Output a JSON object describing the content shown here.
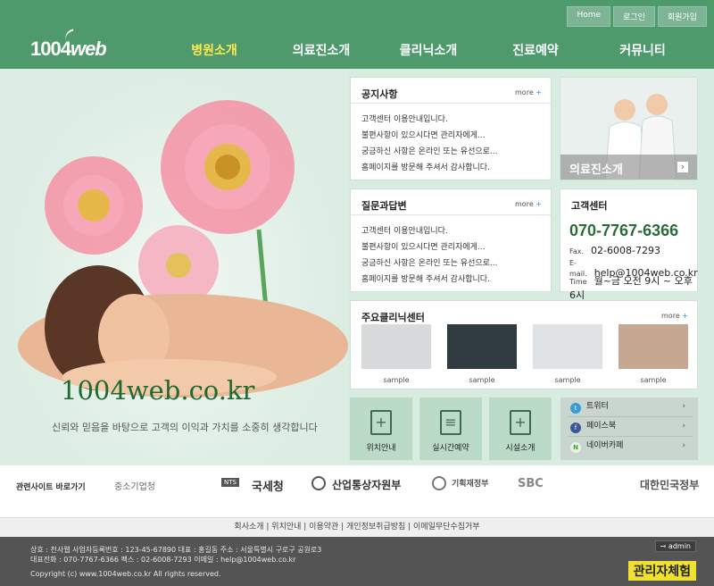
{
  "header": {
    "logo": "1004",
    "logo_web": "web"
  },
  "topnav": [
    "Home",
    "로그인",
    "회원가입"
  ],
  "nav": [
    "병원소개",
    "의료진소개",
    "클리닉소개",
    "진료예약",
    "커뮤니티"
  ],
  "hero": {
    "domain": "1004web.co.kr",
    "slogan": "신뢰와 믿음을 바탕으로 고객의 이익과 가치를 소중히 생각합니다"
  },
  "notice": {
    "title": "공지사항",
    "more": "more",
    "items": [
      "고객센터 이용안내입니다.",
      "불편사항이 있으시다면 관리자에게...",
      "궁금하신 사항은 온라인 또는 유선으로...",
      "홈페이지를 방문해 주셔서 감사합니다."
    ]
  },
  "qna": {
    "title": "질문과답변",
    "more": "more",
    "items": [
      "고객센터 이용안내입니다.",
      "불편사항이 있으시다면 관리자에게...",
      "궁금하신 사항은 온라인 또는 유선으로...",
      "홈페이지를 방문해 주셔서 감사합니다."
    ]
  },
  "staff": {
    "label": "의료진소개",
    "arrow": "›"
  },
  "customer_center": {
    "title": "고객센터",
    "phone": "070-7767-6366",
    "fax_label": "Fax.",
    "fax": "02-6008-7293",
    "email_label": "E-mail.",
    "email": "help@1004web.co.kr",
    "time_label": "Time",
    "time": "월~금 오전 9시 ~ 오후 6시"
  },
  "clinic": {
    "title": "주요클리닉센터",
    "more": "more",
    "items": [
      "sample",
      "sample",
      "sample",
      "sample"
    ]
  },
  "quick": [
    "위치안내",
    "실시간예약",
    "시설소개"
  ],
  "social": [
    {
      "label": "트위터",
      "icon": "twitter-icon",
      "color": "#3a9ad9",
      "glyph": "t"
    },
    {
      "label": "페이스북",
      "icon": "facebook-icon",
      "color": "#3b5998",
      "glyph": "f"
    },
    {
      "label": "네이버카페",
      "icon": "naver-cafe-icon",
      "color": "#eeeeee",
      "glyph": "N"
    }
  ],
  "related": {
    "label": "관련사이트 바로가기",
    "sites": [
      "중소기업청",
      "국세청",
      "산업통상자원부",
      "기획재정부",
      "SBC",
      "대한민국정부"
    ]
  },
  "links": "회사소개 | 위치안내 | 이용약관 | 개인정보취급방침 | 이메일무단수집거부",
  "footer": {
    "line1": "상호 : 천사웹  사업자등록번호 : 123-45-67890  대표 : 홍길동  주소 : 서울특별시 구로구 공원로3",
    "line2": "대표전화 : 070-7767-6366  팩스 : 02-6008-7293  이메일 : help@1004web.co.kr",
    "copyright": "Copyright (c) www.1004web.co.kr All rights reserved.",
    "admin": "admin",
    "admin_exp": "관리자체험"
  }
}
